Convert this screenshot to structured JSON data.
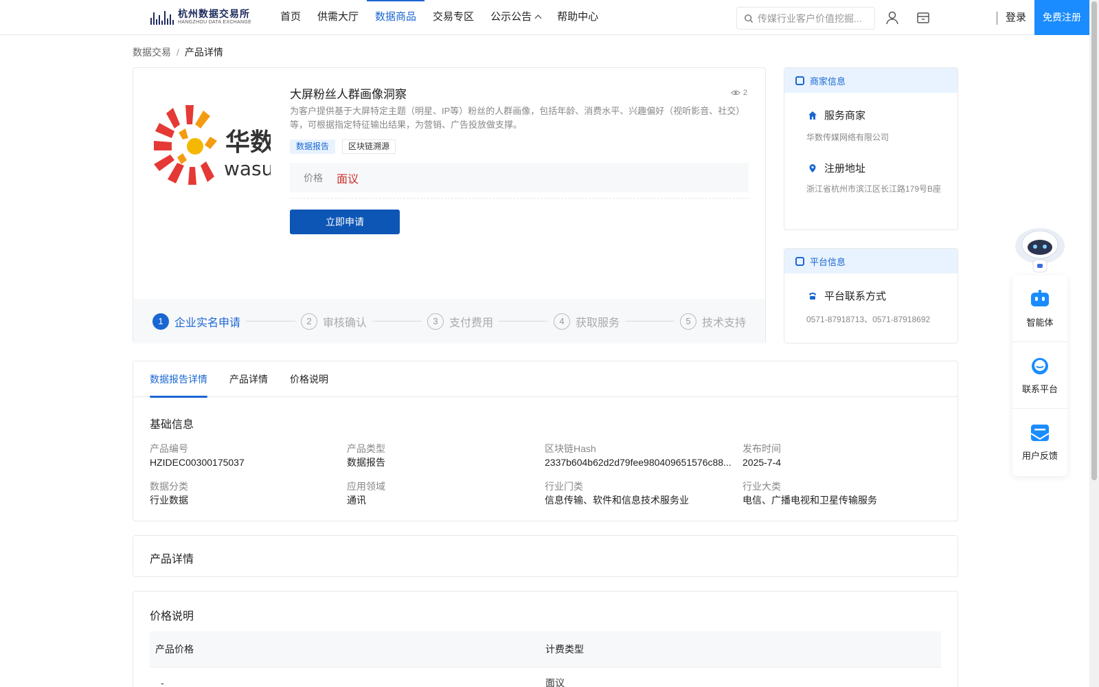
{
  "header": {
    "logo_cn": "杭州数据交易所",
    "logo_en": "HANGZHOU DATA EXCHANGE",
    "nav": [
      {
        "label": "首页"
      },
      {
        "label": "供需大厅"
      },
      {
        "label": "数据商品"
      },
      {
        "label": "交易专区"
      },
      {
        "label": "公示公告"
      },
      {
        "label": "帮助中心"
      }
    ],
    "search_placeholder": "传媒行业客户价值挖掘...",
    "login": "登录",
    "register": "免费注册"
  },
  "breadcrumb": {
    "parent": "数据交易",
    "separator": "/",
    "current": "产品详情"
  },
  "product": {
    "title": "大屏粉丝人群画像洞察",
    "views": "2",
    "description": "为客户提供基于大屏特定主题（明星、IP等）粉丝的人群画像，包括年龄、消费水平、兴趣偏好（视听影音、社交）等，可根据指定特征输出结果，为营销、广告投放做支撑。",
    "tags": [
      "数据报告",
      "区块链溯源"
    ],
    "price_label": "价格",
    "price_value": "面议",
    "apply_button": "立即申请",
    "logo_cn": "华数",
    "logo_en": "wasu",
    "steps": [
      {
        "num": "1",
        "label": "企业实名申请"
      },
      {
        "num": "2",
        "label": "审核确认"
      },
      {
        "num": "3",
        "label": "支付费用"
      },
      {
        "num": "4",
        "label": "获取服务"
      },
      {
        "num": "5",
        "label": "技术支持"
      }
    ]
  },
  "merchant": {
    "title": "商家信息",
    "service_label": "服务商家",
    "service_value": "华数传媒网络有限公司",
    "address_label": "注册地址",
    "address_value": "浙江省杭州市滨江区长江路179号B座"
  },
  "platform": {
    "title": "平台信息",
    "contact_label": "平台联系方式",
    "contact_value": "0571-87918713、0571-87918692"
  },
  "float": [
    {
      "label": "智能体"
    },
    {
      "label": "联系平台"
    },
    {
      "label": "用户反馈"
    }
  ],
  "tabs": [
    {
      "label": "数据报告详情"
    },
    {
      "label": "产品详情"
    },
    {
      "label": "价格说明"
    }
  ],
  "basic": {
    "title": "基础信息",
    "fields": [
      {
        "k": "产品编号",
        "v": "HZIDEC00300175037"
      },
      {
        "k": "产品类型",
        "v": "数据报告"
      },
      {
        "k": "区块链Hash",
        "v": "2337b604b62d2d79fee980409651576c88..."
      },
      {
        "k": "发布时间",
        "v": "2025-7-4"
      },
      {
        "k": "数据分类",
        "v": "行业数据"
      },
      {
        "k": "应用领域",
        "v": "通讯"
      },
      {
        "k": "行业门类",
        "v": "信息传输、软件和信息技术服务业"
      },
      {
        "k": "行业大类",
        "v": "电信、广播电视和卫星传输服务"
      }
    ]
  },
  "detail_section": {
    "title": "产品详情"
  },
  "price_section": {
    "title": "价格说明",
    "headers": [
      "产品价格",
      "计费类型"
    ],
    "rows": [
      [
        "-",
        "面议"
      ]
    ]
  }
}
